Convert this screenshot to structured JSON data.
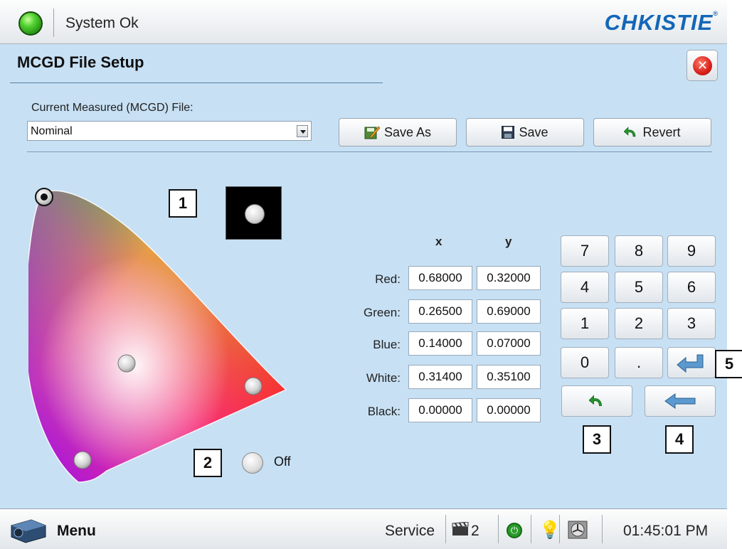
{
  "status": {
    "led_color": "#3cb82a",
    "text": "System Ok"
  },
  "brand": {
    "name": "CHKISTIE",
    "mark": "®"
  },
  "page": {
    "title": "MCGD File Setup"
  },
  "file": {
    "label": "Current Measured (MCGD) File:",
    "selected": "Nominal"
  },
  "buttons": {
    "save_as": "Save As",
    "save": "Save",
    "revert": "Revert"
  },
  "zones": [
    "1",
    "2",
    "3",
    "4",
    "5"
  ],
  "display_toggle": {
    "state": "Off"
  },
  "table": {
    "columns": [
      "x",
      "y"
    ],
    "rows": [
      {
        "label": "Red:",
        "x": "0.68000",
        "y": "0.32000"
      },
      {
        "label": "Green:",
        "x": "0.26500",
        "y": "0.69000"
      },
      {
        "label": "Blue:",
        "x": "0.14000",
        "y": "0.07000"
      },
      {
        "label": "White:",
        "x": "0.31400",
        "y": "0.35100"
      },
      {
        "label": "Black:",
        "x": "0.00000",
        "y": "0.00000"
      }
    ]
  },
  "keypad": {
    "keys": [
      "7",
      "8",
      "9",
      "4",
      "5",
      "6",
      "1",
      "2",
      "3",
      "0",
      "."
    ],
    "enter_icon": "enter-icon",
    "undo_icon": "undo-icon",
    "backspace_icon": "backspace-icon"
  },
  "footer": {
    "menu": "Menu",
    "service": "Service",
    "channel_count": "2",
    "time": "01:45:01 PM"
  },
  "colors": {
    "background": "#c7e0f4",
    "accent": "#1466b8",
    "close": "#d8201a"
  }
}
